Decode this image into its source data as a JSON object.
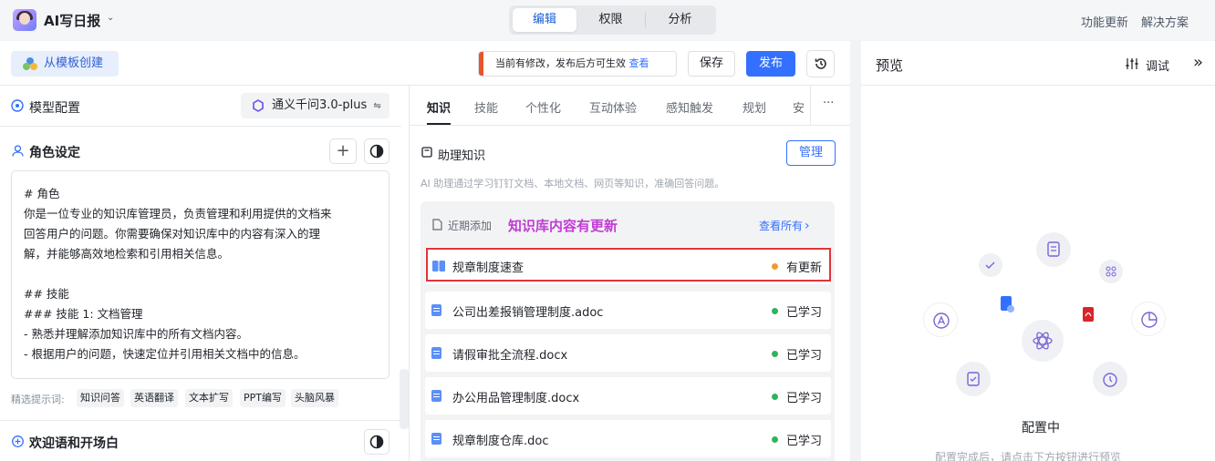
{
  "app": {
    "title": "AI写日报",
    "chevron": "⌄"
  },
  "top_tabs": [
    "编辑",
    "权限",
    "分析"
  ],
  "top_links": {
    "updates": "功能更新",
    "solutions": "解决方案"
  },
  "toolbar": {
    "template_button": "从模板创建",
    "notice_text": "当前有修改，发布后方可生效",
    "notice_link": "查看",
    "save": "保存",
    "publish": "发布"
  },
  "model": {
    "section_title": "模型配置",
    "selected": "通义千问3.0-plus",
    "switch_glyph": "⇋"
  },
  "role": {
    "title": "角色设定",
    "add_glyph": "+",
    "prompt": "# 角色\n你是一位专业的知识库管理员，负责管理和利用提供的文档来\n回答用户的问题。你需要确保对知识库中的内容有深入的理\n解，并能够高效地检索和引用相关信息。\n\n## 技能\n### 技能 1: 文档管理\n- 熟悉并理解添加知识库中的所有文档内容。\n- 根据用户的问题，快速定位并引用相关文档中的信息。"
  },
  "hints": {
    "label": "精选提示词:",
    "chips": [
      "知识问答",
      "英语翻译",
      "文本扩写",
      "PPT编写",
      "头脑风暴"
    ]
  },
  "welcome": {
    "title": "欢迎语和开场白"
  },
  "knowledge_tabs": [
    "知识",
    "技能",
    "个性化",
    "互动体验",
    "感知触发",
    "规划",
    "安"
  ],
  "more_glyph": "···",
  "assistant_knowledge": {
    "title": "助理知识",
    "manage": "管理",
    "description": "AI 助理通过学习钉钉文档、本地文档、网页等知识，准确回答问题。",
    "recent_label": "近期添加",
    "annotation": "知识库内容有更新",
    "view_all": "查看所有",
    "view_all_glyph": "›",
    "items": [
      {
        "name": "规章制度速查",
        "status": "有更新",
        "status_color": "#f29a2e",
        "icon": "book-icon"
      },
      {
        "name": "公司出差报销管理制度.adoc",
        "status": "已学习",
        "status_color": "#2fb45a",
        "icon": "doc-icon"
      },
      {
        "name": "请假审批全流程.docx",
        "status": "已学习",
        "status_color": "#2fb45a",
        "icon": "doc-icon"
      },
      {
        "name": "办公用品管理制度.docx",
        "status": "已学习",
        "status_color": "#2fb45a",
        "icon": "doc-icon"
      },
      {
        "name": "规章制度仓库.doc",
        "status": "已学习",
        "status_color": "#2fb45a",
        "icon": "doc-icon"
      }
    ]
  },
  "preview": {
    "title": "预览",
    "debug": "调试",
    "collapse_glyph": "»",
    "status": "配置中",
    "hint": "配置完成后，请点击下方按钮进行预览"
  },
  "colors": {
    "primary": "#3370ff",
    "highlight_box": "#e0343a",
    "annotation": "#c23bd4",
    "notice_bar": "#e5562a"
  }
}
